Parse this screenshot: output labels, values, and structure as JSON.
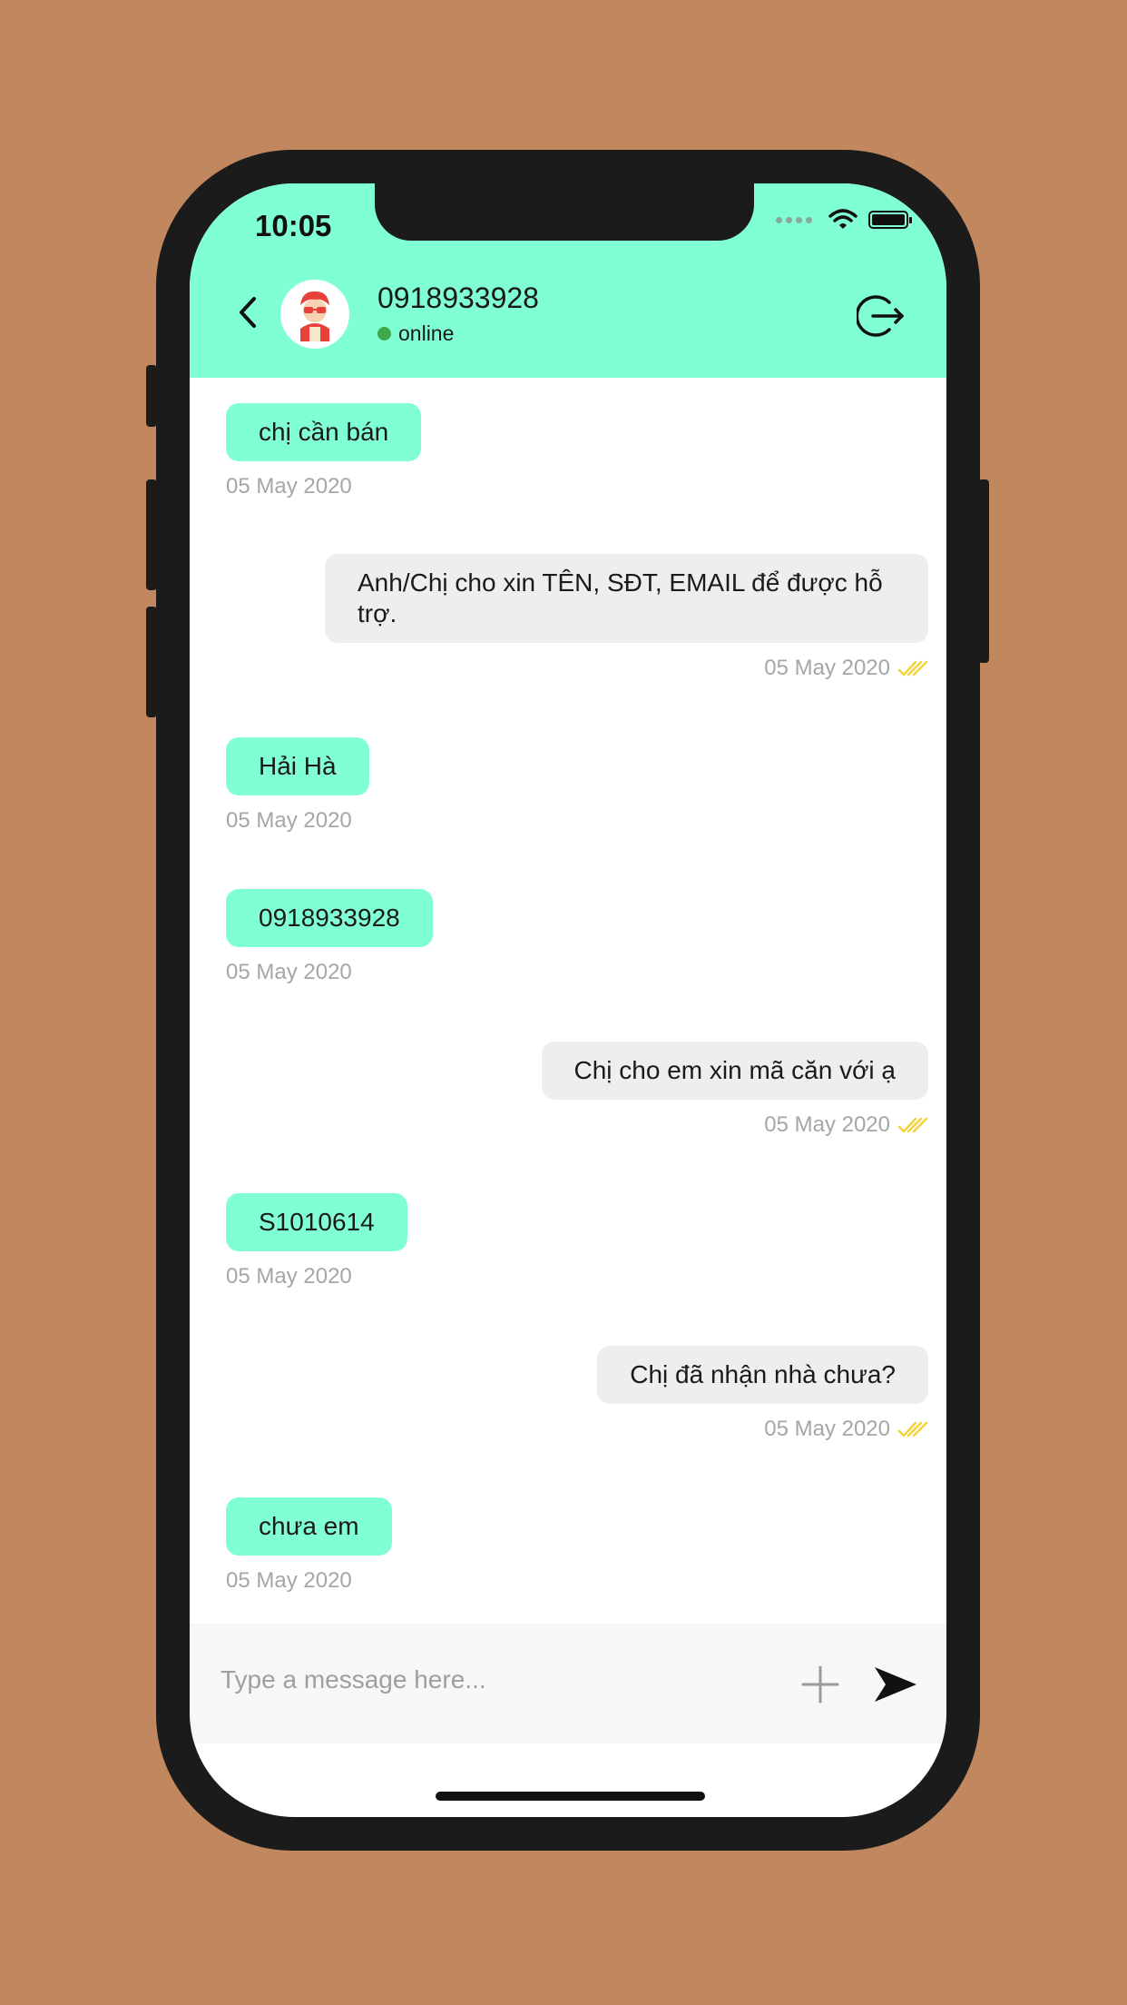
{
  "status_bar": {
    "time": "10:05"
  },
  "header": {
    "contact_name": "0918933928",
    "presence": "online",
    "presence_color": "#3ea84a",
    "accent_color": "#80ffd7"
  },
  "messages": [
    {
      "direction": "incoming",
      "text": "chị cần bán",
      "date": "05 May 2020"
    },
    {
      "direction": "outgoing",
      "text": "Anh/Chị cho xin TÊN, SĐT, EMAIL để được hỗ trợ.",
      "date": "05 May 2020",
      "status_icon": "double-check-icon"
    },
    {
      "direction": "incoming",
      "text": "Hải Hà",
      "date": "05 May 2020"
    },
    {
      "direction": "incoming",
      "text": "0918933928",
      "date": "05 May 2020"
    },
    {
      "direction": "outgoing",
      "text": "Chị cho em xin mã căn với ạ",
      "date": "05 May 2020",
      "status_icon": "double-check-icon"
    },
    {
      "direction": "incoming",
      "text": "S1010614",
      "date": "05 May 2020"
    },
    {
      "direction": "outgoing",
      "text": "Chị đã nhận nhà chưa?",
      "date": "05 May 2020",
      "status_icon": "double-check-icon"
    },
    {
      "direction": "incoming",
      "text": "chưa em",
      "date": "05 May 2020"
    }
  ],
  "composer": {
    "placeholder": "Type a message here...",
    "attach_icon": "plus-icon",
    "send_icon": "send-icon"
  }
}
